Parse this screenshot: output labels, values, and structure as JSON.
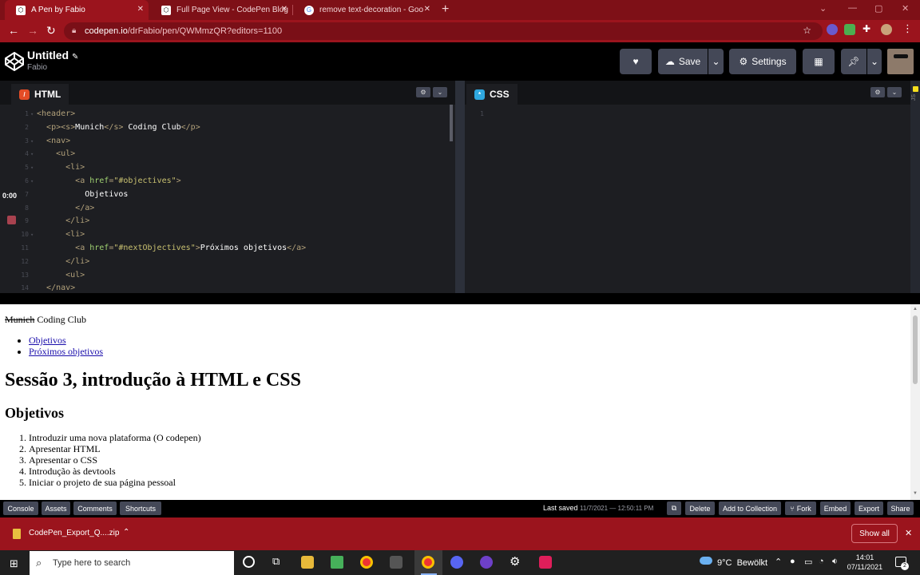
{
  "browser": {
    "tabs": [
      {
        "title": "A Pen by Fabio",
        "favicon": "codepen-icon",
        "active": true
      },
      {
        "title": "Full Page View - CodePen Blog",
        "favicon": "codepen-icon",
        "active": false
      },
      {
        "title": "remove text-decoration - Google",
        "favicon": "google-icon",
        "active": false
      }
    ],
    "url_host": "codepen.io",
    "url_path": "/drFabio/pen/QWMmzQR?editors=1100"
  },
  "codepen": {
    "title": "Untitled",
    "author": "Fabio",
    "buttons": {
      "save": "Save",
      "settings": "Settings"
    }
  },
  "editors": {
    "html": {
      "label": "HTML",
      "lines": [
        {
          "n": "1",
          "fold": "▾",
          "html": "<span class='t'>&lt;header&gt;</span>"
        },
        {
          "n": "2",
          "fold": "",
          "html": "  <span class='t'>&lt;p&gt;&lt;s&gt;</span><span class='x'>Munich</span><span class='t'>&lt;/s&gt;</span><span class='x'> Coding Club</span><span class='t'>&lt;/p&gt;</span>"
        },
        {
          "n": "3",
          "fold": "▾",
          "html": "  <span class='t'>&lt;nav&gt;</span>"
        },
        {
          "n": "4",
          "fold": "▾",
          "html": "    <span class='t'>&lt;ul&gt;</span>"
        },
        {
          "n": "5",
          "fold": "▾",
          "html": "      <span class='t'>&lt;li&gt;</span>"
        },
        {
          "n": "6",
          "fold": "▾",
          "html": "        <span class='t'>&lt;a </span><span class='a'>href</span><span class='t'>=</span><span class='s'>\"#objectives\"</span><span class='t'>&gt;</span>"
        },
        {
          "n": "7",
          "fold": "",
          "html": "          <span class='x'>Objetivos</span>"
        },
        {
          "n": "8",
          "fold": "",
          "html": "        <span class='t'>&lt;/a&gt;</span>"
        },
        {
          "n": "9",
          "fold": "",
          "html": "      <span class='t'>&lt;/li&gt;</span>"
        },
        {
          "n": "10",
          "fold": "▾",
          "html": "      <span class='t'>&lt;li&gt;</span>"
        },
        {
          "n": "11",
          "fold": "",
          "html": "        <span class='t'>&lt;a </span><span class='a'>href</span><span class='t'>=</span><span class='s'>\"#nextObjectives\"</span><span class='t'>&gt;</span><span class='x'>Próximos objetivos</span><span class='t'>&lt;/a&gt;</span>"
        },
        {
          "n": "12",
          "fold": "",
          "html": "      <span class='t'>&lt;/li&gt;</span>"
        },
        {
          "n": "13",
          "fold": "",
          "html": "      <span class='t'>&lt;ul&gt;</span>"
        },
        {
          "n": "14",
          "fold": "",
          "html": "  <span class='t'>&lt;/nav&gt;</span>"
        }
      ]
    },
    "css": {
      "label": "CSS",
      "line_number": "1"
    },
    "timer": "0:00",
    "side_label": "JS"
  },
  "preview": {
    "strike": "Munich",
    "header_rest": " Coding Club",
    "nav_links": [
      "Objetivos",
      "Próximos objetivos"
    ],
    "h1": "Sessão 3, introdução à HTML e CSS",
    "h2": "Objetivos",
    "objectives": [
      "Introduzir uma nova plataforma (O codepen)",
      "Apresentar HTML",
      "Apresentar o CSS",
      "Introdução às devtools",
      "Iniciar o projeto de sua página pessoal"
    ]
  },
  "footer": {
    "left": [
      "Console",
      "Assets",
      "Comments",
      "Shortcuts"
    ],
    "last_saved_label": "Last saved",
    "last_saved_time": "11/7/2021 — 12:50:11 PM",
    "right": [
      "Delete",
      "Add to Collection",
      "Fork",
      "Embed",
      "Export",
      "Share"
    ]
  },
  "download": {
    "file": "CodePen_Export_Q....zip",
    "show_all": "Show all"
  },
  "taskbar": {
    "search_placeholder": "Type here to search",
    "weather": "9°C  Bewölkt",
    "time": "14:01",
    "date": "07/11/2021",
    "notif_count": "2"
  },
  "colors": {
    "chrome_red": "#9b141d",
    "codepen_bg": "#1d1e22",
    "button": "#444857"
  }
}
